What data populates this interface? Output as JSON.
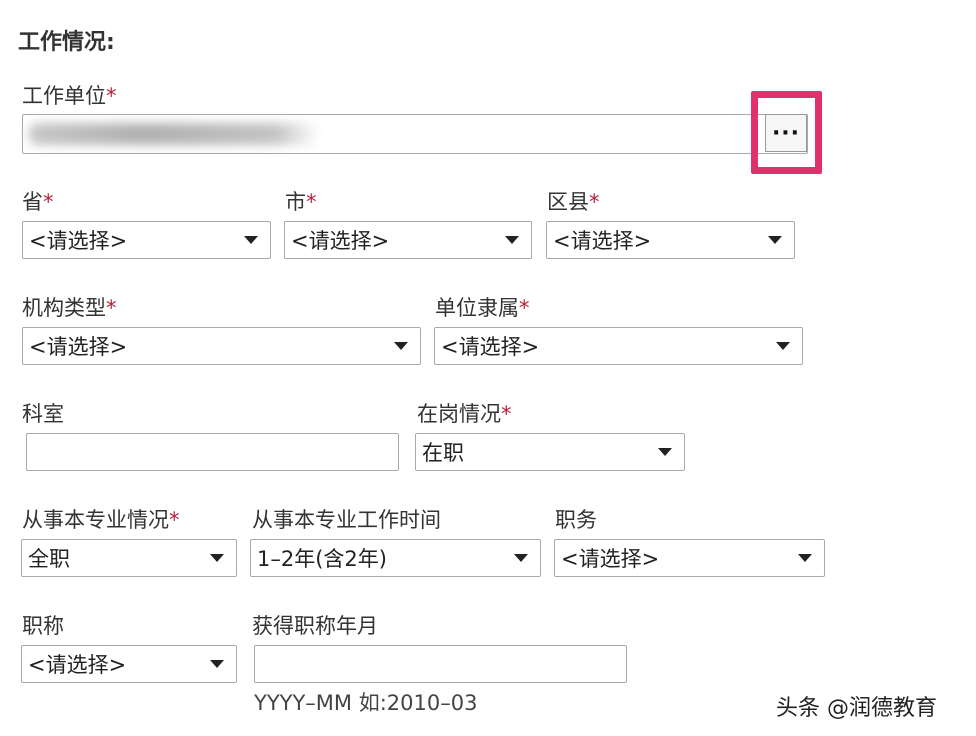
{
  "section": {
    "title": "工作情况:"
  },
  "required_mark": "*",
  "work_unit": {
    "label": "工作单位",
    "ellipsis": "···"
  },
  "province": {
    "label": "省",
    "value": "<请选择>"
  },
  "city": {
    "label": "市",
    "value": "<请选择>"
  },
  "district": {
    "label": "区县",
    "value": "<请选择>"
  },
  "org_type": {
    "label": "机构类型",
    "value": "<请选择>"
  },
  "unit_affiliation": {
    "label": "单位隶属",
    "value": "<请选择>"
  },
  "department": {
    "label": "科室",
    "value": ""
  },
  "post_status": {
    "label": "在岗情况",
    "value": "在职"
  },
  "major_status": {
    "label": "从事本专业情况",
    "value": "全职"
  },
  "major_time": {
    "label": "从事本专业工作时间",
    "value": "1–2年(含2年)"
  },
  "position": {
    "label": "职务",
    "value": "<请选择>"
  },
  "title": {
    "label": "职称",
    "value": "<请选择>"
  },
  "title_date": {
    "label": "获得职称年月",
    "value": "",
    "hint": "YYYY–MM 如:2010–03"
  },
  "watermark": "头条 @润德教育",
  "colors": {
    "highlight": "#e2306f",
    "required": "#b5213a",
    "border": "#a9a9a9"
  }
}
